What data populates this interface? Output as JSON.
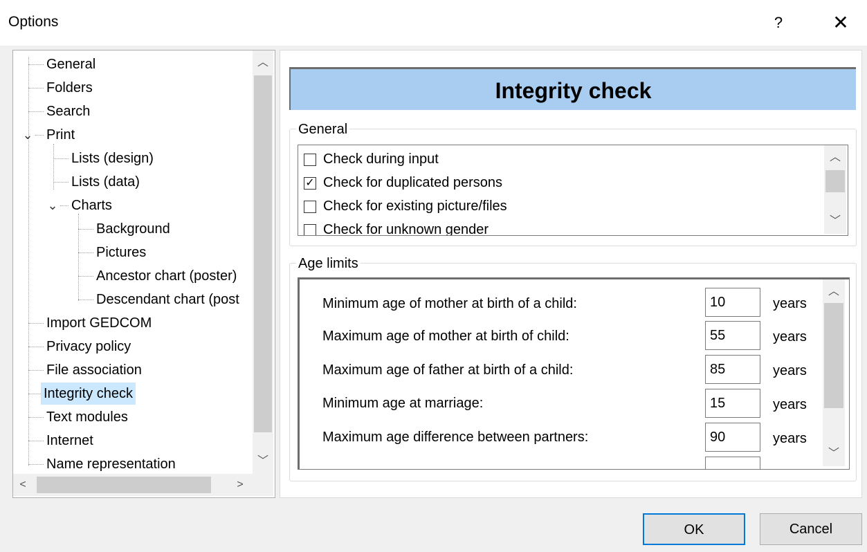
{
  "window": {
    "title": "Options",
    "help": "?",
    "close": "✕"
  },
  "tree": {
    "items": [
      {
        "label": "General"
      },
      {
        "label": "Folders"
      },
      {
        "label": "Search"
      },
      {
        "label": "Print"
      },
      {
        "label": "Lists (design)"
      },
      {
        "label": "Lists (data)"
      },
      {
        "label": "Charts"
      },
      {
        "label": "Background"
      },
      {
        "label": "Pictures"
      },
      {
        "label": "Ancestor chart (poster)"
      },
      {
        "label": "Descendant chart (post"
      },
      {
        "label": "Import GEDCOM"
      },
      {
        "label": "Privacy policy"
      },
      {
        "label": "File association"
      },
      {
        "label": "Integrity check"
      },
      {
        "label": "Text modules"
      },
      {
        "label": "Internet"
      },
      {
        "label": "Name representation"
      }
    ],
    "selected": "Integrity check"
  },
  "panel": {
    "header": "Integrity check",
    "general": {
      "label": "General",
      "checks": [
        {
          "label": "Check during input",
          "checked": false
        },
        {
          "label": "Check for duplicated persons",
          "checked": true
        },
        {
          "label": "Check for existing picture/files",
          "checked": false
        },
        {
          "label": "Check for unknown gender",
          "checked": false
        }
      ]
    },
    "age_limits": {
      "label": "Age limits",
      "rows": [
        {
          "label": "Minimum age of mother at birth of a child:",
          "value": "10",
          "unit": "years"
        },
        {
          "label": "Maximum age of mother at birth of child:",
          "value": "55",
          "unit": "years"
        },
        {
          "label": "Maximum age of father at birth of a child:",
          "value": "85",
          "unit": "years"
        },
        {
          "label": "Minimum age at marriage:",
          "value": "15",
          "unit": "years"
        },
        {
          "label": "Maximum age difference between partners:",
          "value": "90",
          "unit": "years"
        }
      ]
    }
  },
  "buttons": {
    "ok": "OK",
    "cancel": "Cancel"
  }
}
